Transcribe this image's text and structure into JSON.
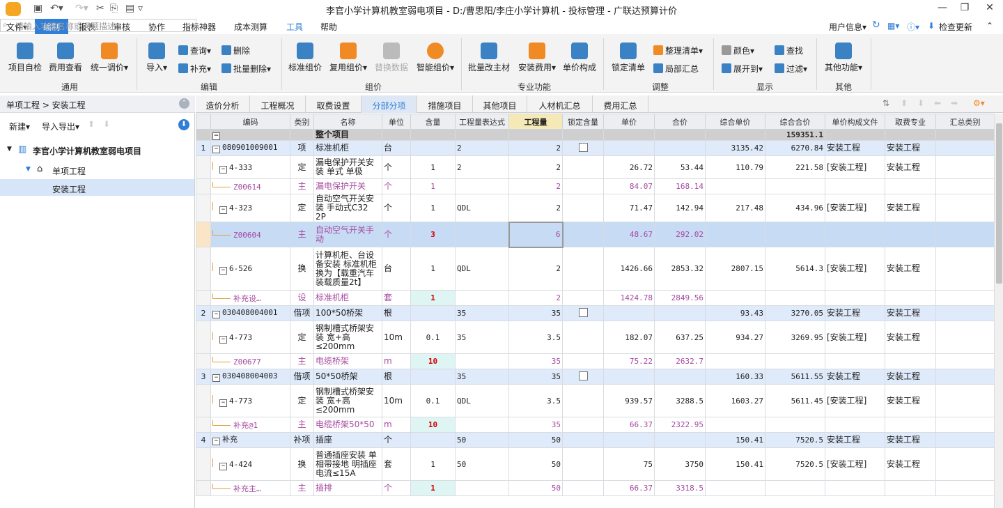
{
  "window": {
    "title": "李官小学计算机教室弱电项目 - D:/曹思阳/李庄小学计算机 - 投标管理 - 广联达预算计价"
  },
  "menubar": {
    "items": [
      "文件▾",
      "编制",
      "报表",
      "审核",
      "协作",
      "指标神器",
      "成本测算",
      "工具",
      "帮助"
    ],
    "search_placeholder": "请输入功能名称或问题描述",
    "user_info": "用户信息▾",
    "check_update": "检查更新"
  },
  "ribbon": {
    "groups": [
      {
        "label": "通用",
        "buttons": [
          "项目自检",
          "费用查看",
          "统一调价▾"
        ]
      },
      {
        "label": "编辑",
        "buttons": [
          "导入▾",
          "查询▾",
          "删除",
          "补充▾",
          "批量删除▾"
        ]
      },
      {
        "label": "组价",
        "buttons": [
          "标准组价",
          "复用组价▾",
          "替换数据",
          "智能组价▾"
        ]
      },
      {
        "label": "专业功能",
        "buttons": [
          "批量改主材",
          "安装费用▾",
          "单价构成"
        ]
      },
      {
        "label": "调整",
        "buttons": [
          "锁定清单",
          "整理清单▾",
          "局部汇总"
        ]
      },
      {
        "label": "显示",
        "buttons": [
          "颜色▾",
          "查找",
          "展开到▾",
          "过滤▾"
        ]
      },
      {
        "label": "其他",
        "buttons": [
          "其他功能▾"
        ]
      }
    ]
  },
  "left": {
    "breadcrumb": "单项工程 > 安装工程",
    "new": "新建▾",
    "import_export": "导入导出▾",
    "tree": [
      "李官小学计算机教室弱电项目",
      "单项工程",
      "安装工程"
    ]
  },
  "tabs": [
    "造价分析",
    "工程概况",
    "取费设置",
    "分部分项",
    "措施项目",
    "其他项目",
    "人材机汇总",
    "费用汇总"
  ],
  "grid": {
    "columns": [
      "",
      "编码",
      "类别",
      "名称",
      "单位",
      "含量",
      "工程量表达式",
      "工程量",
      "锁定含量",
      "单价",
      "合价",
      "综合单价",
      "综合合价",
      "单价构成文件",
      "取费专业",
      "汇总类别"
    ],
    "total_label": "整个项目",
    "total_value": "159351.1",
    "rows": [
      {
        "no": "1",
        "code": "080901009001",
        "type": "项",
        "name": "标准机柜",
        "unit": "台",
        "qty_rate": "",
        "expr": "2",
        "qty": "2",
        "lock": true,
        "price": "",
        "total": "",
        "cprice": "3135.42",
        "ctotal": "6270.84",
        "file": "安装工程",
        "spec": "安装工程",
        "kind": "list"
      },
      {
        "no": "",
        "code": "4-333",
        "type": "定",
        "name": "漏电保护开关安装 单式 单极",
        "unit": "个",
        "qty_rate": "1",
        "expr": "2",
        "qty": "2",
        "lock": false,
        "price": "26.72",
        "total": "53.44",
        "cprice": "110.79",
        "ctotal": "221.58",
        "file": "[安装工程]",
        "spec": "安装工程",
        "kind": "quota"
      },
      {
        "no": "",
        "code": "Z00614",
        "type": "主",
        "name": "漏电保护开关",
        "unit": "个",
        "qty_rate": "1",
        "expr": "",
        "qty": "2",
        "lock": false,
        "price": "84.07",
        "total": "168.14",
        "cprice": "",
        "ctotal": "",
        "file": "",
        "spec": "",
        "kind": "main"
      },
      {
        "no": "",
        "code": "4-323",
        "type": "定",
        "name": "自动空气开关安装 手动式C32 2P",
        "unit": "个",
        "qty_rate": "1",
        "expr": "QDL",
        "qty": "2",
        "lock": false,
        "price": "71.47",
        "total": "142.94",
        "cprice": "217.48",
        "ctotal": "434.96",
        "file": "[安装工程]",
        "spec": "安装工程",
        "kind": "quota"
      },
      {
        "no": "",
        "code": "Z00604",
        "type": "主",
        "name": "自动空气开关手动",
        "unit": "个",
        "qty_rate": "3",
        "expr": "",
        "qty": "6",
        "lock": false,
        "price": "48.67",
        "total": "292.02",
        "cprice": "",
        "ctotal": "",
        "file": "",
        "spec": "",
        "kind": "sel"
      },
      {
        "no": "",
        "code": "6-526",
        "type": "换",
        "name": "计算机柜、台设备安装 标准机柜 换为【载重汽车 装载质量2t】",
        "unit": "台",
        "qty_rate": "1",
        "expr": "QDL",
        "qty": "2",
        "lock": false,
        "price": "1426.66",
        "total": "2853.32",
        "cprice": "2807.15",
        "ctotal": "5614.3",
        "file": "[安装工程]",
        "spec": "安装工程",
        "kind": "quota"
      },
      {
        "no": "",
        "code": "补充设…",
        "type": "设",
        "name": "标准机柜",
        "unit": "套",
        "qty_rate": "1",
        "expr": "",
        "qty": "2",
        "lock": false,
        "price": "1424.78",
        "total": "2849.56",
        "cprice": "",
        "ctotal": "",
        "file": "",
        "spec": "",
        "kind": "main-mark"
      },
      {
        "no": "2",
        "code": "030408004001",
        "type": "借项",
        "name": "100*50桥架",
        "unit": "根",
        "qty_rate": "",
        "expr": "35",
        "qty": "35",
        "lock": true,
        "price": "",
        "total": "",
        "cprice": "93.43",
        "ctotal": "3270.05",
        "file": "安装工程",
        "spec": "安装工程",
        "kind": "list"
      },
      {
        "no": "",
        "code": "4-773",
        "type": "定",
        "name": "钢制槽式桥架安装 宽+高≤200mm",
        "unit": "10m",
        "qty_rate": "0.1",
        "expr": "35",
        "qty": "3.5",
        "lock": false,
        "price": "182.07",
        "total": "637.25",
        "cprice": "934.27",
        "ctotal": "3269.95",
        "file": "[安装工程]",
        "spec": "安装工程",
        "kind": "quota"
      },
      {
        "no": "",
        "code": "Z00677",
        "type": "主",
        "name": "电缆桥架",
        "unit": "m",
        "qty_rate": "10",
        "expr": "",
        "qty": "35",
        "lock": false,
        "price": "75.22",
        "total": "2632.7",
        "cprice": "",
        "ctotal": "",
        "file": "",
        "spec": "",
        "kind": "main-mark"
      },
      {
        "no": "3",
        "code": "030408004003",
        "type": "借项",
        "name": "50*50桥架",
        "unit": "根",
        "qty_rate": "",
        "expr": "35",
        "qty": "35",
        "lock": true,
        "price": "",
        "total": "",
        "cprice": "160.33",
        "ctotal": "5611.55",
        "file": "安装工程",
        "spec": "安装工程",
        "kind": "list"
      },
      {
        "no": "",
        "code": "4-773",
        "type": "定",
        "name": "钢制槽式桥架安装 宽+高≤200mm",
        "unit": "10m",
        "qty_rate": "0.1",
        "expr": "QDL",
        "qty": "3.5",
        "lock": false,
        "price": "939.57",
        "total": "3288.5",
        "cprice": "1603.27",
        "ctotal": "5611.45",
        "file": "[安装工程]",
        "spec": "安装工程",
        "kind": "quota"
      },
      {
        "no": "",
        "code": "补充@1",
        "type": "主",
        "name": "电缆桥架50*50",
        "unit": "m",
        "qty_rate": "10",
        "expr": "",
        "qty": "35",
        "lock": false,
        "price": "66.37",
        "total": "2322.95",
        "cprice": "",
        "ctotal": "",
        "file": "",
        "spec": "",
        "kind": "main-mark"
      },
      {
        "no": "4",
        "code": "补充",
        "type": "补项",
        "name": "插座",
        "unit": "个",
        "qty_rate": "",
        "expr": "50",
        "qty": "50",
        "lock": false,
        "price": "",
        "total": "",
        "cprice": "150.41",
        "ctotal": "7520.5",
        "file": "安装工程",
        "spec": "安装工程",
        "kind": "list"
      },
      {
        "no": "",
        "code": "4-424",
        "type": "换",
        "name": "普通插座安装 单相带接地 明插座 电流≤15A",
        "unit": "套",
        "qty_rate": "1",
        "expr": "50",
        "qty": "50",
        "lock": false,
        "price": "75",
        "total": "3750",
        "cprice": "150.41",
        "ctotal": "7520.5",
        "file": "[安装工程]",
        "spec": "安装工程",
        "kind": "quota"
      },
      {
        "no": "",
        "code": "补充主…",
        "type": "主",
        "name": "插排",
        "unit": "个",
        "qty_rate": "1",
        "expr": "",
        "qty": "50",
        "lock": false,
        "price": "66.37",
        "total": "3318.5",
        "cprice": "",
        "ctotal": "",
        "file": "",
        "spec": "",
        "kind": "main-mark"
      }
    ]
  },
  "colors": {
    "accent": "#2f7ed8",
    "list_row": "#dfeafa",
    "main_material": "#a64aa0",
    "selected_row": "#c7dbf5",
    "marker_red": "#d00000"
  }
}
